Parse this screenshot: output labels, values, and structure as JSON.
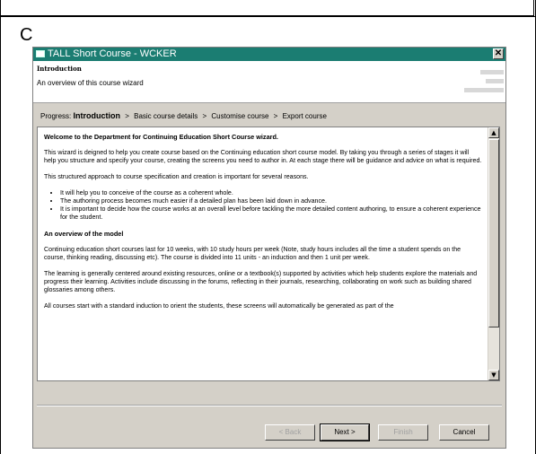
{
  "figure_label": "C",
  "window": {
    "title": "TALL Short Course - WCKER",
    "close_glyph": "✕"
  },
  "header": {
    "title": "Introduction",
    "subtitle": "An overview of this course wizard"
  },
  "progress": {
    "label": "Progress:",
    "current": "Introduction",
    "steps": [
      "Basic course details",
      "Customise course",
      "Export course"
    ],
    "separator": ">"
  },
  "content": {
    "heading": "Welcome to the Department for Continuing Education Short Course wizard.",
    "para1": "This wizard is deigned to help you create course based on the Continuing education short course model. By taking you through a series of stages it will help you structure and specify your course, creating the screens you need to author in. At each stage there will be guidance and advice on what is required.",
    "para2": "This structured approach to course specification and creation is important for several reasons.",
    "bullets": [
      "It will help you to conceive of the course as a coherent whole.",
      "The authoring process becomes much easier if a detailed plan has been laid down in advance.",
      "It is important to decide how the course works at an overall level before tackling the more detailed content authoring, to ensure a coherent experience for the student."
    ],
    "heading2": "An overview of the model",
    "para3": "Continuing education short courses last for 10 weeks, with 10 study hours per week (Note, study hours includes all the time a student spends on the course, thinking reading, discussing etc). The course is divided into 11 units - an induction and then 1 unit per week.",
    "para4": "The learning is generally centered around existing resources, online or a textbook(s) supported by activities which help students explore the materials and progress their learning. Activities include discussing in the forums, reflecting in their journals, researching, collaborating on work such as building shared glossaries among others.",
    "para5": "All courses start with a standard induction to orient the students, these screens will automatically be generated as part of the"
  },
  "scrollbar": {
    "up_glyph": "▲",
    "down_glyph": "▼"
  },
  "buttons": {
    "back": "< Back",
    "next": "Next >",
    "finish": "Finish",
    "cancel": "Cancel"
  }
}
